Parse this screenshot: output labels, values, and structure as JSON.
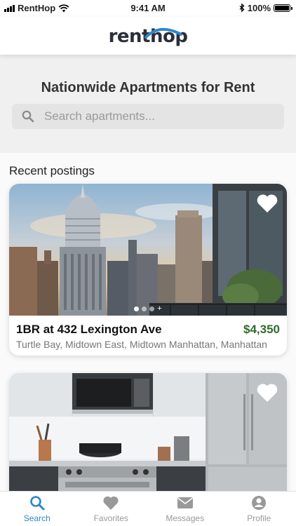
{
  "status_bar": {
    "carrier": "RentHop",
    "time": "9:41 AM",
    "battery": "100%"
  },
  "header": {
    "logo_text": "renthop",
    "logo_color": "#2b2f3a",
    "logo_accent": "#2e86c8"
  },
  "hero": {
    "title": "Nationwide Apartments for Rent",
    "search_placeholder": "Search apartments..."
  },
  "recent": {
    "title": "Recent postings",
    "listings": [
      {
        "title": "1BR at 432 Lexington Ave",
        "price": "$4,350",
        "location": "Turtle Bay, Midtown East, Midtown Manhattan, Manhattan",
        "photo": "city-skyline-photo"
      },
      {
        "title": "",
        "price": "",
        "location": "",
        "photo": "kitchen-photo"
      }
    ]
  },
  "tabbar": {
    "tabs": [
      {
        "label": "Search",
        "icon": "search-icon",
        "active": true
      },
      {
        "label": "Favorites",
        "icon": "heart-icon",
        "active": false
      },
      {
        "label": "Messages",
        "icon": "envelope-icon",
        "active": false
      },
      {
        "label": "Profile",
        "icon": "person-icon",
        "active": false
      }
    ]
  },
  "colors": {
    "accent": "#2e86c8",
    "price": "#2e6b2e"
  }
}
